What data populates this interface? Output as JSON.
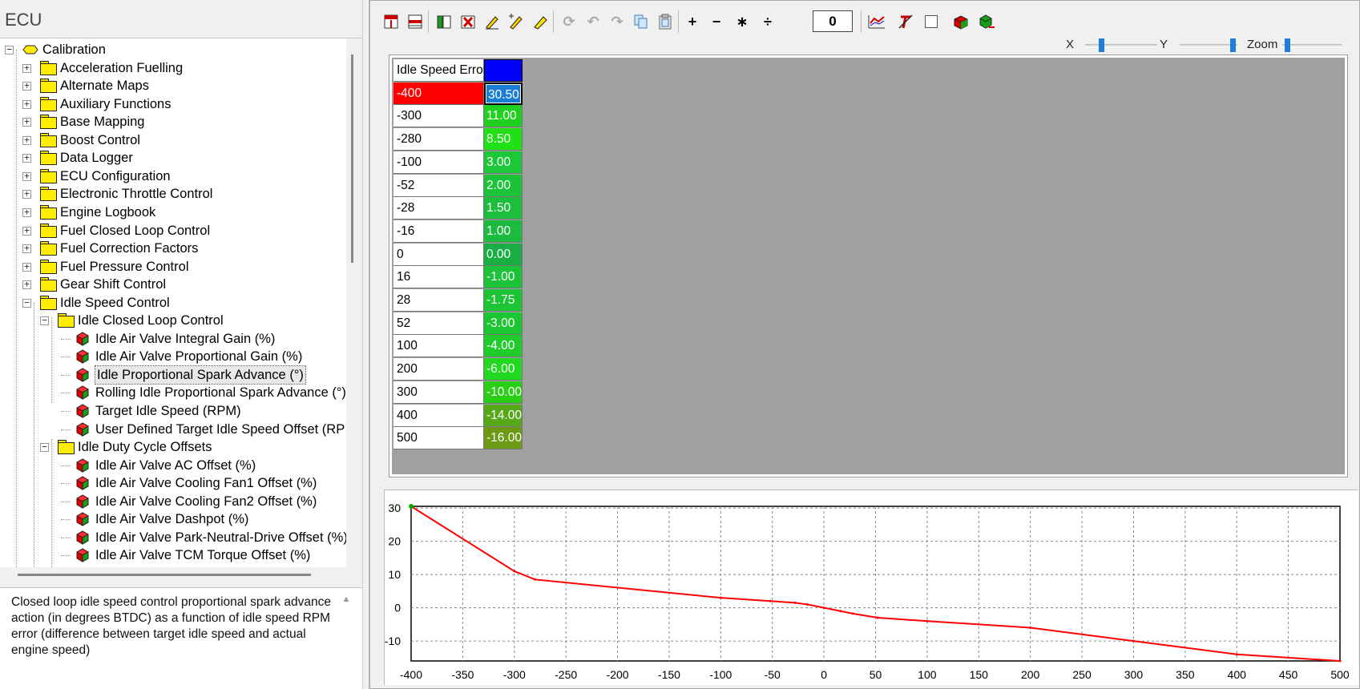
{
  "app": {
    "panel_title": "ECU"
  },
  "tree": {
    "root": "Calibration",
    "folders": [
      "Acceleration Fuelling",
      "Alternate Maps",
      "Auxiliary Functions",
      "Base Mapping",
      "Boost Control",
      "Data Logger",
      "ECU Configuration",
      "Electronic Throttle Control",
      "Engine Logbook",
      "Fuel Closed Loop Control",
      "Fuel Correction Factors",
      "Fuel Pressure Control",
      "Gear Shift Control",
      "Idle Speed Control"
    ],
    "idle_closed_loop": {
      "label": "Idle Closed Loop Control",
      "items": [
        "Idle Air Valve Integral Gain (%)",
        "Idle Air Valve Proportional Gain (%)",
        "Idle Proportional Spark Advance (°)",
        "Rolling Idle Proportional Spark Advance (°)",
        "Target Idle Speed (RPM)",
        "User Defined Target Idle Speed Offset (RP"
      ]
    },
    "idle_duty_cycle": {
      "label": "Idle Duty Cycle Offsets",
      "items": [
        "Idle Air Valve AC Offset (%)",
        "Idle Air Valve Cooling Fan1 Offset (%)",
        "Idle Air Valve Cooling Fan2 Offset (%)",
        "Idle Air Valve Dashpot (%)",
        "Idle Air Valve Park-Neutral-Drive Offset (%)",
        "Idle Air Valve TCM Torque Offset (%)"
      ]
    }
  },
  "description": "Closed loop idle speed control proportional spark advance action (in degrees BTDC) as a function of idle speed RPM error (difference between target idle speed and actual engine speed)",
  "toolbar": {
    "value": "0",
    "plus": "+",
    "minus": "−",
    "multiply": "∗",
    "divide": "÷",
    "sliders": {
      "x_label": "X",
      "y_label": "Y",
      "zoom_label": "Zoom",
      "x_level": 0.2,
      "y_level": 0.97,
      "zoom_level": 0.05
    }
  },
  "table": {
    "header": "Idle Speed Error",
    "rows": [
      {
        "axis": "-400",
        "value": "30.50",
        "color": "#1a7fd4"
      },
      {
        "axis": "-300",
        "value": "11.00",
        "color": "#20d020"
      },
      {
        "axis": "-280",
        "value": "8.50",
        "color": "#22e018"
      },
      {
        "axis": "-100",
        "value": "3.00",
        "color": "#1cc838"
      },
      {
        "axis": "-52",
        "value": "2.00",
        "color": "#1cc238"
      },
      {
        "axis": "-28",
        "value": "1.50",
        "color": "#1cbe3c"
      },
      {
        "axis": "-16",
        "value": "1.00",
        "color": "#1cba3e"
      },
      {
        "axis": "0",
        "value": "0.00",
        "color": "#18ae44"
      },
      {
        "axis": "16",
        "value": "-1.00",
        "color": "#1cc238"
      },
      {
        "axis": "28",
        "value": "-1.75",
        "color": "#1cc436"
      },
      {
        "axis": "52",
        "value": "-3.00",
        "color": "#1cc632"
      },
      {
        "axis": "100",
        "value": "-4.00",
        "color": "#1fcc2c"
      },
      {
        "axis": "200",
        "value": "-6.00",
        "color": "#22d820"
      },
      {
        "axis": "300",
        "value": "-10.00",
        "color": "#2bce16"
      },
      {
        "axis": "400",
        "value": "-14.00",
        "color": "#56a818"
      },
      {
        "axis": "500",
        "value": "-16.00",
        "color": "#6b9a14"
      }
    ]
  },
  "chart_data": {
    "type": "line",
    "x": [
      -400,
      -300,
      -280,
      -100,
      -52,
      -28,
      -16,
      0,
      16,
      28,
      52,
      100,
      200,
      300,
      400,
      500
    ],
    "series": [
      {
        "values": [
          30.5,
          11,
          8.5,
          3,
          2,
          1.5,
          1,
          0,
          -1,
          -1.75,
          -3,
          -4,
          -6,
          -10,
          -14,
          -16
        ],
        "color": "#ff0000"
      }
    ],
    "xlim": [
      -400,
      500
    ],
    "ylim": [
      -16,
      31
    ],
    "xticks": [
      "-400",
      "-350",
      "-300",
      "-250",
      "-200",
      "-150",
      "-100",
      "-50",
      "0",
      "50",
      "100",
      "150",
      "200",
      "250",
      "300",
      "350",
      "400",
      "450",
      "500"
    ],
    "yticks": [
      "30",
      "20",
      "10",
      "0",
      "-10"
    ],
    "grid": true
  }
}
